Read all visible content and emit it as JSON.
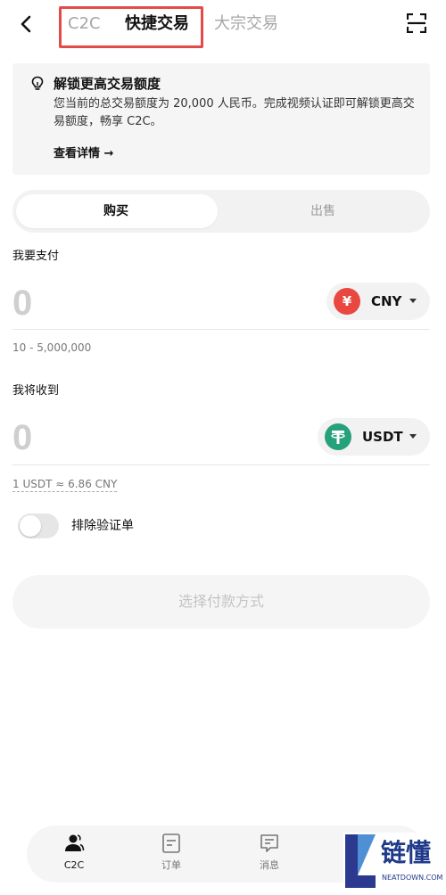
{
  "header": {
    "tabs": [
      {
        "label": "C2C"
      },
      {
        "label": "快捷交易"
      },
      {
        "label": "大宗交易"
      }
    ],
    "back_icon": "back-arrow-icon",
    "scan_icon": "scan-icon"
  },
  "banner": {
    "icon": "lightbulb-icon",
    "title": "解锁更高交易额度",
    "text": "您当前的总交易额度为 20,000 人民币。完成视频认证即可解锁更高交易额度，畅享 C2C。",
    "link": "查看详情 →"
  },
  "segment": {
    "buy": "购买",
    "sell": "出售",
    "selected": "购买"
  },
  "pay": {
    "label": "我要支付",
    "amount": "0",
    "currency": "CNY",
    "currency_symbol": "¥",
    "currency_color": "#e8483f",
    "range": "10 - 5,000,000"
  },
  "receive": {
    "label": "我将收到",
    "amount": "0",
    "currency": "USDT",
    "currency_symbol": "T",
    "currency_color": "#26a17b",
    "rate": "1 USDT ≈ 6.86 CNY"
  },
  "filter": {
    "label": "排除验证单",
    "enabled": false
  },
  "action": {
    "label": "选择付款方式"
  },
  "bottom_nav": [
    {
      "label": "C2C",
      "icon": "user-icon",
      "active": true
    },
    {
      "label": "订单",
      "icon": "order-icon",
      "active": false
    },
    {
      "label": "消息",
      "icon": "message-icon",
      "active": false
    }
  ],
  "watermark": {
    "text": "链懂",
    "sub": "NEATDOWN.COM"
  }
}
